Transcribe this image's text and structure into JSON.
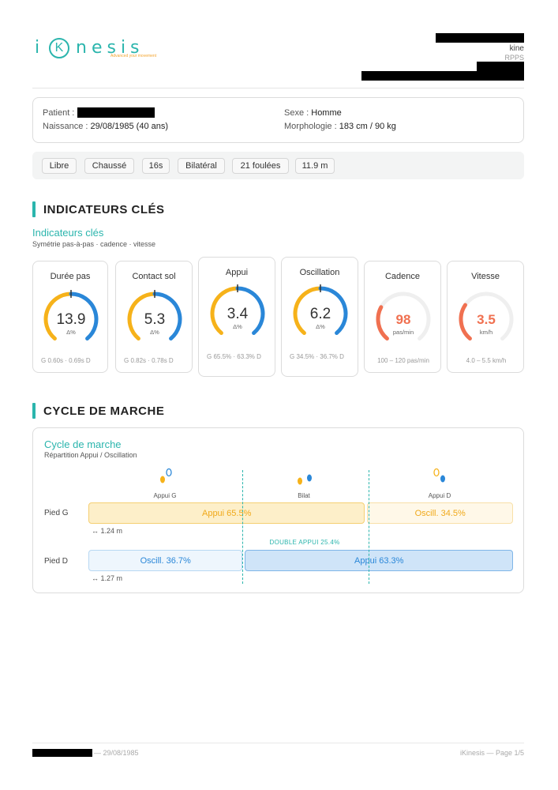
{
  "header": {
    "logo_text": "iKinesis",
    "logo_letter": "K",
    "logo_tagline": "Advanced your movement",
    "practitioner_role": "kine",
    "practitioner_id_label": "RPPS"
  },
  "patient": {
    "patient_label": "Patient :",
    "birth_label": "Naissance :",
    "birth_value": "29/08/1985 (40 ans)",
    "sex_label": "Sexe :",
    "sex_value": "Homme",
    "morpho_label": "Morphologie :",
    "morpho_value": "183 cm / 90 kg"
  },
  "chips": [
    "Libre",
    "Chaussé",
    "16s",
    "Bilatéral",
    "21 foulées",
    "11.9 m"
  ],
  "sections": {
    "indicators_title": "INDICATEURS CLÉS",
    "indicators_sub": "Indicateurs clés",
    "indicators_caption": "Symétrie pas-à-pas · cadence · vitesse",
    "cycle_title": "CYCLE DE MARCHE",
    "cycle_sub": "Cycle de marche",
    "cycle_caption": "Répartition Appui / Oscillation"
  },
  "gauges": [
    {
      "title": "Durée pas",
      "value": "13.9",
      "unit": "Δ%",
      "foot": "G 0.60s · 0.69s D",
      "kind": "symmetry",
      "level": 0.5
    },
    {
      "title": "Contact sol",
      "value": "5.3",
      "unit": "Δ%",
      "foot": "G 0.82s · 0.78s D",
      "kind": "symmetry",
      "level": 0.5
    },
    {
      "title": "Appui",
      "value": "3.4",
      "unit": "Δ%",
      "foot": "G 65.5% · 63.3% D",
      "kind": "symmetry",
      "level": 0.5
    },
    {
      "title": "Oscillation",
      "value": "6.2",
      "unit": "Δ%",
      "foot": "G 34.5% · 36.7% D",
      "kind": "symmetry",
      "level": 0.5
    },
    {
      "title": "Cadence",
      "value": "98",
      "unit": "pas/min",
      "foot": "100 – 120 pas/min",
      "kind": "range",
      "level": 0.28
    },
    {
      "title": "Vitesse",
      "value": "3.5",
      "unit": "km/h",
      "foot": "4.0 – 5.5 km/h",
      "kind": "range",
      "level": 0.3
    }
  ],
  "gait": {
    "phase_left": "Appui G",
    "phase_mid": "Bilat",
    "phase_right": "Appui D",
    "left_foot_label": "Pied G",
    "right_foot_label": "Pied D",
    "left_stance": "Appui 65.5%",
    "left_swing": "Oscill. 34.5%",
    "right_swing": "Oscill. 36.7%",
    "right_stance": "Appui 63.3%",
    "left_distance": "↔ 1.24 m",
    "right_distance": "↔ 1.27 m",
    "double_support": "DOUBLE APPUI 25.4%",
    "left_stance_pct": 65.5,
    "right_swing_pct": 36.7
  },
  "footer": {
    "birth": "— 29/08/1985",
    "page": "iKinesis — Page 1/5"
  },
  "colors": {
    "accent": "#2bb5ad",
    "left": "#f6b21a",
    "right": "#2a87d8",
    "alert": "#f07050"
  }
}
